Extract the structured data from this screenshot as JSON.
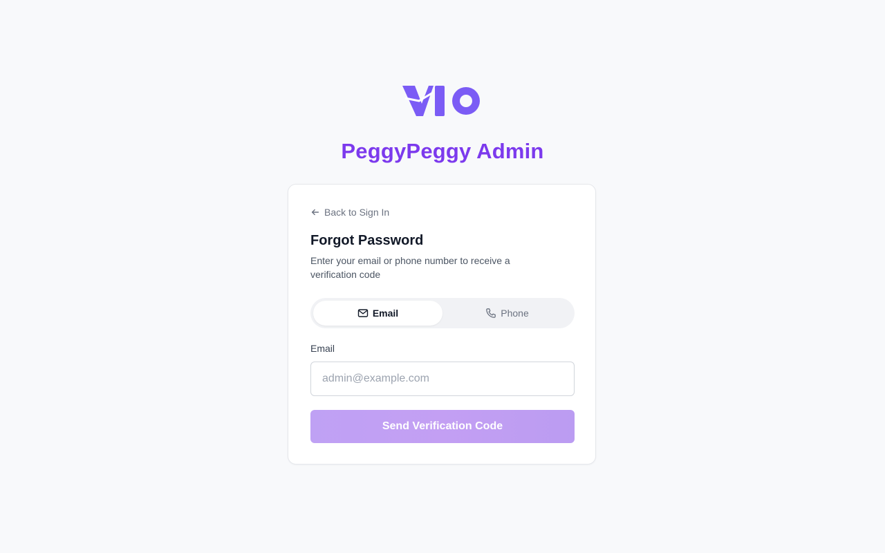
{
  "brand": {
    "logo_text": "VIO",
    "title": "PeggyPeggy Admin",
    "accent_color": "#7c3aed",
    "logo_color": "#7b5cf5"
  },
  "card": {
    "back_link": {
      "icon": "arrow-left-icon",
      "label": "Back to Sign In"
    },
    "heading": "Forgot Password",
    "subtext": "Enter your email or phone number to receive a verification code",
    "tabs": [
      {
        "label": "Email",
        "icon": "mail-icon",
        "active": true
      },
      {
        "label": "Phone",
        "icon": "phone-icon",
        "active": false
      }
    ],
    "email_field": {
      "label": "Email",
      "value": "",
      "placeholder": "admin@example.com"
    },
    "submit_button": {
      "label": "Send Verification Code",
      "color": "#c09ff4"
    }
  }
}
